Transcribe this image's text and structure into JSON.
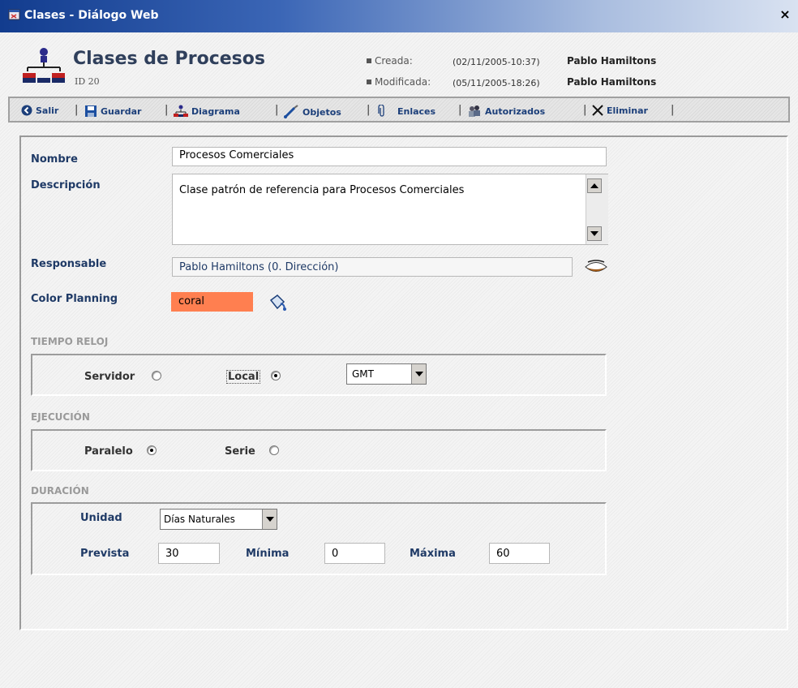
{
  "window": {
    "title": "Clases - Diálogo Web",
    "close_label": "×"
  },
  "header": {
    "title": "Clases de Procesos",
    "id_label": "ID  20",
    "created_label": "Creada:",
    "created_date": "(02/11/2005-10:37)",
    "created_user": "Pablo Hamiltons",
    "modified_label": "Modificada:",
    "modified_date": "(05/11/2005-18:26)",
    "modified_user": "Pablo Hamiltons"
  },
  "toolbar": {
    "salir": "Salir",
    "guardar": "Guardar",
    "diagrama": "Diagrama",
    "objetos": "Objetos",
    "enlaces": "Enlaces",
    "autorizados": "Autorizados",
    "eliminar": "Eliminar",
    "separator": "|"
  },
  "form": {
    "nombre_label": "Nombre",
    "nombre_value": "Procesos Comerciales",
    "descripcion_label": "Descripción",
    "descripcion_value": "Clase patrón de referencia para Procesos Comerciales",
    "responsable_label": "Responsable",
    "responsable_value": "Pablo  Hamiltons (0. Dirección)",
    "color_label": "Color Planning",
    "color_value": "coral",
    "color_hex": "#ff7f50"
  },
  "tiempo_reloj": {
    "title": "TIEMPO RELOJ",
    "servidor_label": "Servidor",
    "local_label": "Local",
    "selected": "Local",
    "timezone": "GMT"
  },
  "ejecucion": {
    "title": "EJECUCIÓN",
    "paralelo_label": "Paralelo",
    "serie_label": "Serie",
    "selected": "Paralelo"
  },
  "duracion": {
    "title": "DURACIÓN",
    "unidad_label": "Unidad",
    "unidad_value": "Días Naturales",
    "prevista_label": "Prevista",
    "prevista_value": "30",
    "minima_label": "Mínima",
    "minima_value": "0",
    "maxima_label": "Máxima",
    "maxima_value": "60"
  },
  "colors": {
    "label_blue": "#1f3a66",
    "title_bar": "#123c8e",
    "coral": "#ff7f50"
  }
}
